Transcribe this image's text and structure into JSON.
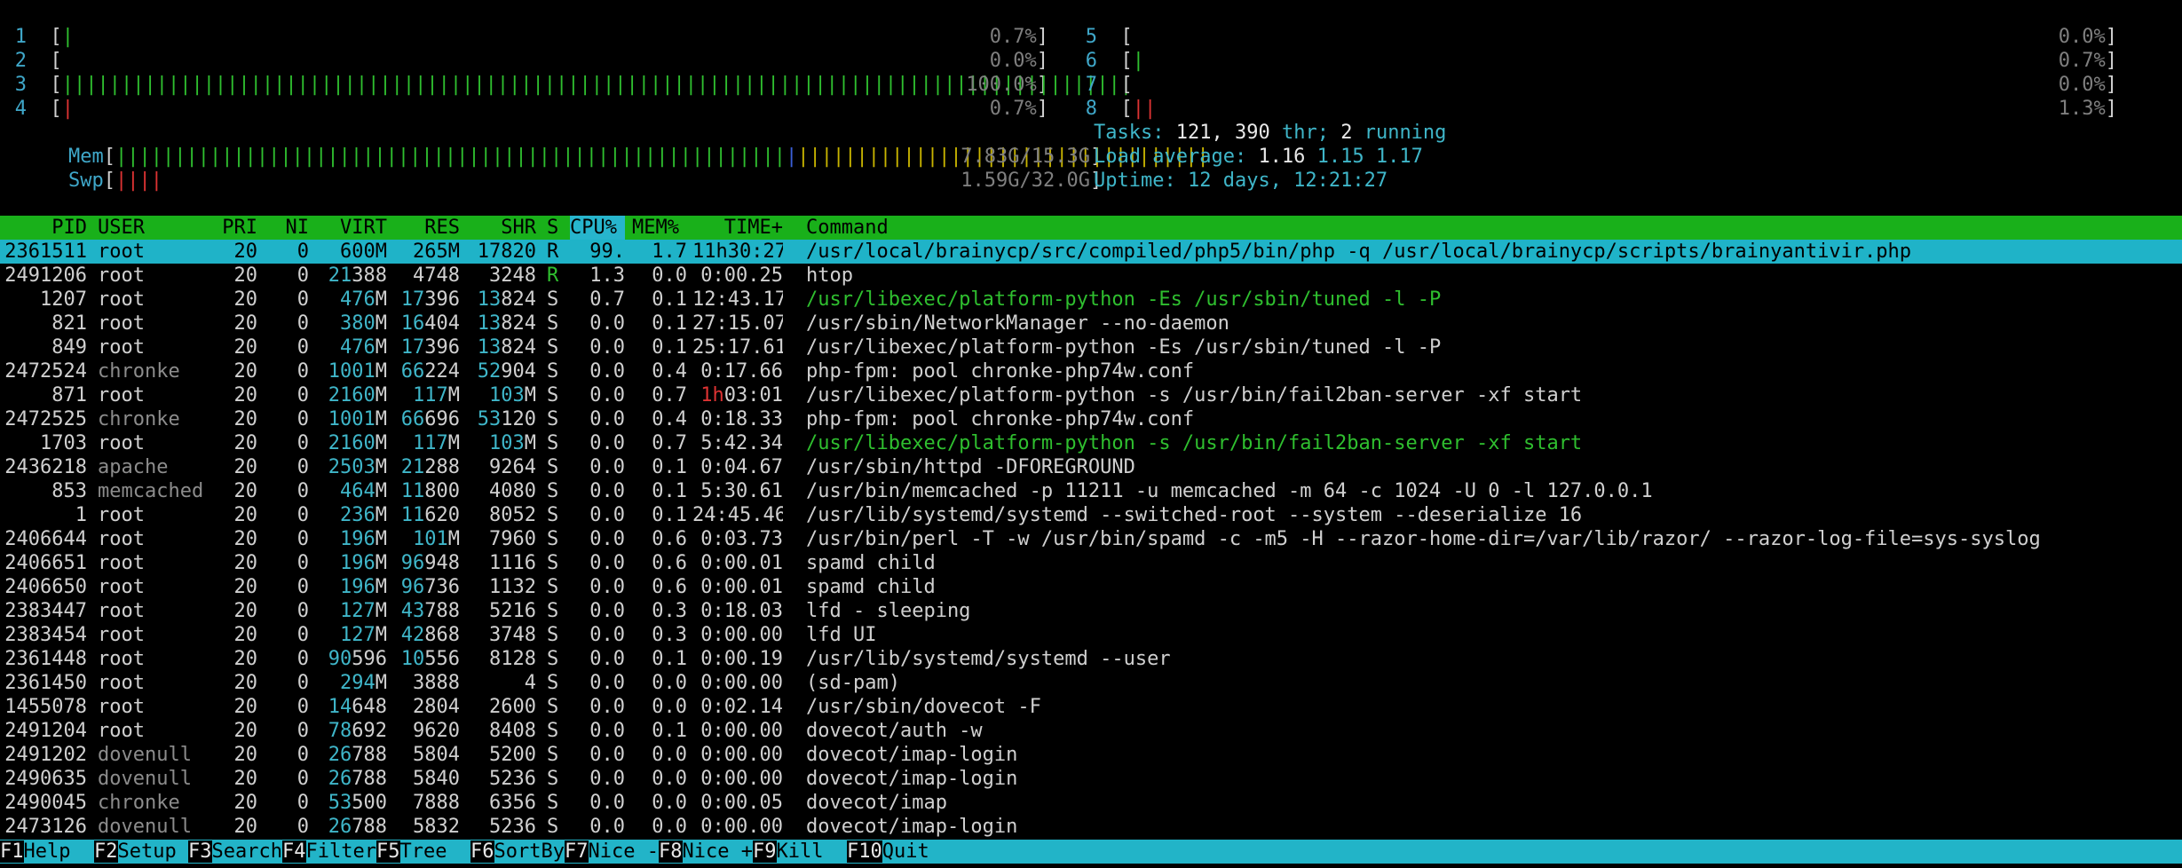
{
  "cpu_left": [
    {
      "id": "1",
      "percent": "0.7%",
      "bars": "|",
      "bar_color": "green"
    },
    {
      "id": "2",
      "percent": "0.0%",
      "bars": "",
      "bar_color": "green"
    },
    {
      "id": "3",
      "percent": "100.0%",
      "bars": "|||||||||||||||||||||||||||||||||||||||||||||||||||||||||||||||||||||||||||||||||||||||||||",
      "bar_color": "green"
    },
    {
      "id": "4",
      "percent": "0.7%",
      "bars": "|",
      "bar_color": "red"
    }
  ],
  "cpu_right": [
    {
      "id": "5",
      "percent": "0.0%",
      "bars": "",
      "bar_color": "green"
    },
    {
      "id": "6",
      "percent": "0.7%",
      "bars": "|",
      "bar_color": "green"
    },
    {
      "id": "7",
      "percent": "0.0%",
      "bars": "",
      "bar_color": "green"
    },
    {
      "id": "8",
      "percent": "1.3%",
      "bars": "||",
      "bar_color": "red"
    }
  ],
  "mem": {
    "label": "Mem",
    "value": "7.83G/15.3G"
  },
  "swp": {
    "label": "Swp",
    "value": "1.59G/32.0G",
    "bars": "||||"
  },
  "tasks": {
    "label": "Tasks:",
    "count": "121,",
    "thr": "390",
    "thr_label": "thr;",
    "running": "2",
    "running_label": "running"
  },
  "load": {
    "label": "Load average:",
    "v1": "1.16",
    "v2": "1.15",
    "v3": "1.17"
  },
  "uptime": {
    "label": "Uptime:",
    "value": "12 days, 12:21:27"
  },
  "colors": {
    "header_bg": "#19b01a",
    "selected_bg": "#1fb3c8",
    "fkey_bg": "#22b4c8"
  },
  "columns": {
    "pid": "PID",
    "user": "USER",
    "pri": "PRI",
    "ni": "NI",
    "virt": "VIRT",
    "res": "RES",
    "shr": "SHR",
    "s": "S",
    "cpu": "CPU%",
    "mem": "MEM%",
    "time": "TIME+",
    "command": "Command"
  },
  "processes": [
    {
      "pid": "2361511",
      "user": "root",
      "pri": "20",
      "ni": "0",
      "virt": "600M",
      "res": "265M",
      "shr": "17820",
      "s": "R",
      "cpu": "99.",
      "mem": "1.7",
      "time": "11h30:27",
      "command": "/usr/local/brainycp/src/compiled/php5/bin/php -q /usr/local/brainycp/scripts/brainyantivir.php",
      "selected": true
    },
    {
      "pid": "2491206",
      "user": "root",
      "pri": "20",
      "ni": "0",
      "virt": "21388",
      "res": "4748",
      "shr": "3248",
      "s": "R",
      "cpu": "1.3",
      "mem": "0.0",
      "time": "0:00.25",
      "command": "htop"
    },
    {
      "pid": "1207",
      "user": "root",
      "pri": "20",
      "ni": "0",
      "virt": "476M",
      "res": "17396",
      "shr": "13824",
      "s": "S",
      "cpu": "0.7",
      "mem": "0.1",
      "time": "12:43.17",
      "command": "/usr/libexec/platform-python -Es /usr/sbin/tuned -l -P",
      "thread": true
    },
    {
      "pid": "821",
      "user": "root",
      "pri": "20",
      "ni": "0",
      "virt": "380M",
      "res": "16404",
      "shr": "13824",
      "s": "S",
      "cpu": "0.0",
      "mem": "0.1",
      "time": "27:15.07",
      "command": "/usr/sbin/NetworkManager --no-daemon"
    },
    {
      "pid": "849",
      "user": "root",
      "pri": "20",
      "ni": "0",
      "virt": "476M",
      "res": "17396",
      "shr": "13824",
      "s": "S",
      "cpu": "0.0",
      "mem": "0.1",
      "time": "25:17.61",
      "command": "/usr/libexec/platform-python -Es /usr/sbin/tuned -l -P"
    },
    {
      "pid": "2472524",
      "user": "chronke",
      "pri": "20",
      "ni": "0",
      "virt": "1001M",
      "res": "66224",
      "shr": "52904",
      "s": "S",
      "cpu": "0.0",
      "mem": "0.4",
      "time": "0:17.66",
      "command": "php-fpm: pool chronke-php74w.conf"
    },
    {
      "pid": "871",
      "user": "root",
      "pri": "20",
      "ni": "0",
      "virt": "2160M",
      "res": "117M",
      "shr": "103M",
      "s": "S",
      "cpu": "0.0",
      "mem": "0.7",
      "time": "1h03:01",
      "command": "/usr/libexec/platform-python -s /usr/bin/fail2ban-server -xf start"
    },
    {
      "pid": "2472525",
      "user": "chronke",
      "pri": "20",
      "ni": "0",
      "virt": "1001M",
      "res": "66696",
      "shr": "53120",
      "s": "S",
      "cpu": "0.0",
      "mem": "0.4",
      "time": "0:18.33",
      "command": "php-fpm: pool chronke-php74w.conf"
    },
    {
      "pid": "1703",
      "user": "root",
      "pri": "20",
      "ni": "0",
      "virt": "2160M",
      "res": "117M",
      "shr": "103M",
      "s": "S",
      "cpu": "0.0",
      "mem": "0.7",
      "time": "5:42.34",
      "command": "/usr/libexec/platform-python -s /usr/bin/fail2ban-server -xf start",
      "thread": true
    },
    {
      "pid": "2436218",
      "user": "apache",
      "pri": "20",
      "ni": "0",
      "virt": "2503M",
      "res": "21288",
      "shr": "9264",
      "s": "S",
      "cpu": "0.0",
      "mem": "0.1",
      "time": "0:04.67",
      "command": "/usr/sbin/httpd -DFOREGROUND"
    },
    {
      "pid": "853",
      "user": "memcached",
      "pri": "20",
      "ni": "0",
      "virt": "464M",
      "res": "11800",
      "shr": "4080",
      "s": "S",
      "cpu": "0.0",
      "mem": "0.1",
      "time": "5:30.61",
      "command": "/usr/bin/memcached -p 11211 -u memcached -m 64 -c 1024 -U 0 -l 127.0.0.1"
    },
    {
      "pid": "1",
      "user": "root",
      "pri": "20",
      "ni": "0",
      "virt": "236M",
      "res": "11620",
      "shr": "8052",
      "s": "S",
      "cpu": "0.0",
      "mem": "0.1",
      "time": "24:45.46",
      "command": "/usr/lib/systemd/systemd --switched-root --system --deserialize 16"
    },
    {
      "pid": "2406644",
      "user": "root",
      "pri": "20",
      "ni": "0",
      "virt": "196M",
      "res": "101M",
      "shr": "7960",
      "s": "S",
      "cpu": "0.0",
      "mem": "0.6",
      "time": "0:03.73",
      "command": "/usr/bin/perl -T -w /usr/bin/spamd -c -m5 -H --razor-home-dir=/var/lib/razor/ --razor-log-file=sys-syslog"
    },
    {
      "pid": "2406651",
      "user": "root",
      "pri": "20",
      "ni": "0",
      "virt": "196M",
      "res": "96948",
      "shr": "1116",
      "s": "S",
      "cpu": "0.0",
      "mem": "0.6",
      "time": "0:00.01",
      "command": "spamd child"
    },
    {
      "pid": "2406650",
      "user": "root",
      "pri": "20",
      "ni": "0",
      "virt": "196M",
      "res": "96736",
      "shr": "1132",
      "s": "S",
      "cpu": "0.0",
      "mem": "0.6",
      "time": "0:00.01",
      "command": "spamd child"
    },
    {
      "pid": "2383447",
      "user": "root",
      "pri": "20",
      "ni": "0",
      "virt": "127M",
      "res": "43788",
      "shr": "5216",
      "s": "S",
      "cpu": "0.0",
      "mem": "0.3",
      "time": "0:18.03",
      "command": "lfd - sleeping"
    },
    {
      "pid": "2383454",
      "user": "root",
      "pri": "20",
      "ni": "0",
      "virt": "127M",
      "res": "42868",
      "shr": "3748",
      "s": "S",
      "cpu": "0.0",
      "mem": "0.3",
      "time": "0:00.00",
      "command": "lfd UI"
    },
    {
      "pid": "2361448",
      "user": "root",
      "pri": "20",
      "ni": "0",
      "virt": "90596",
      "res": "10556",
      "shr": "8128",
      "s": "S",
      "cpu": "0.0",
      "mem": "0.1",
      "time": "0:00.19",
      "command": "/usr/lib/systemd/systemd --user"
    },
    {
      "pid": "2361450",
      "user": "root",
      "pri": "20",
      "ni": "0",
      "virt": "294M",
      "res": "3888",
      "shr": "4",
      "s": "S",
      "cpu": "0.0",
      "mem": "0.0",
      "time": "0:00.00",
      "command": "(sd-pam)"
    },
    {
      "pid": "1455078",
      "user": "root",
      "pri": "20",
      "ni": "0",
      "virt": "14648",
      "res": "2804",
      "shr": "2600",
      "s": "S",
      "cpu": "0.0",
      "mem": "0.0",
      "time": "0:02.14",
      "command": "/usr/sbin/dovecot -F"
    },
    {
      "pid": "2491204",
      "user": "root",
      "pri": "20",
      "ni": "0",
      "virt": "78692",
      "res": "9620",
      "shr": "8408",
      "s": "S",
      "cpu": "0.0",
      "mem": "0.1",
      "time": "0:00.00",
      "command": "dovecot/auth -w"
    },
    {
      "pid": "2491202",
      "user": "dovenull",
      "pri": "20",
      "ni": "0",
      "virt": "26788",
      "res": "5804",
      "shr": "5200",
      "s": "S",
      "cpu": "0.0",
      "mem": "0.0",
      "time": "0:00.00",
      "command": "dovecot/imap-login"
    },
    {
      "pid": "2490635",
      "user": "dovenull",
      "pri": "20",
      "ni": "0",
      "virt": "26788",
      "res": "5840",
      "shr": "5236",
      "s": "S",
      "cpu": "0.0",
      "mem": "0.0",
      "time": "0:00.00",
      "command": "dovecot/imap-login"
    },
    {
      "pid": "2490045",
      "user": "chronke",
      "pri": "20",
      "ni": "0",
      "virt": "53500",
      "res": "7888",
      "shr": "6356",
      "s": "S",
      "cpu": "0.0",
      "mem": "0.0",
      "time": "0:00.05",
      "command": "dovecot/imap"
    },
    {
      "pid": "2473126",
      "user": "dovenull",
      "pri": "20",
      "ni": "0",
      "virt": "26788",
      "res": "5832",
      "shr": "5236",
      "s": "S",
      "cpu": "0.0",
      "mem": "0.0",
      "time": "0:00.00",
      "command": "dovecot/imap-login"
    }
  ],
  "fkeys": [
    {
      "key": "F1",
      "label": "Help  "
    },
    {
      "key": "F2",
      "label": "Setup "
    },
    {
      "key": "F3",
      "label": "Search"
    },
    {
      "key": "F4",
      "label": "Filter"
    },
    {
      "key": "F5",
      "label": "Tree  "
    },
    {
      "key": "F6",
      "label": "SortBy"
    },
    {
      "key": "F7",
      "label": "Nice -"
    },
    {
      "key": "F8",
      "label": "Nice +"
    },
    {
      "key": "F9",
      "label": "Kill  "
    },
    {
      "key": "F10",
      "label": "Quit  "
    }
  ]
}
